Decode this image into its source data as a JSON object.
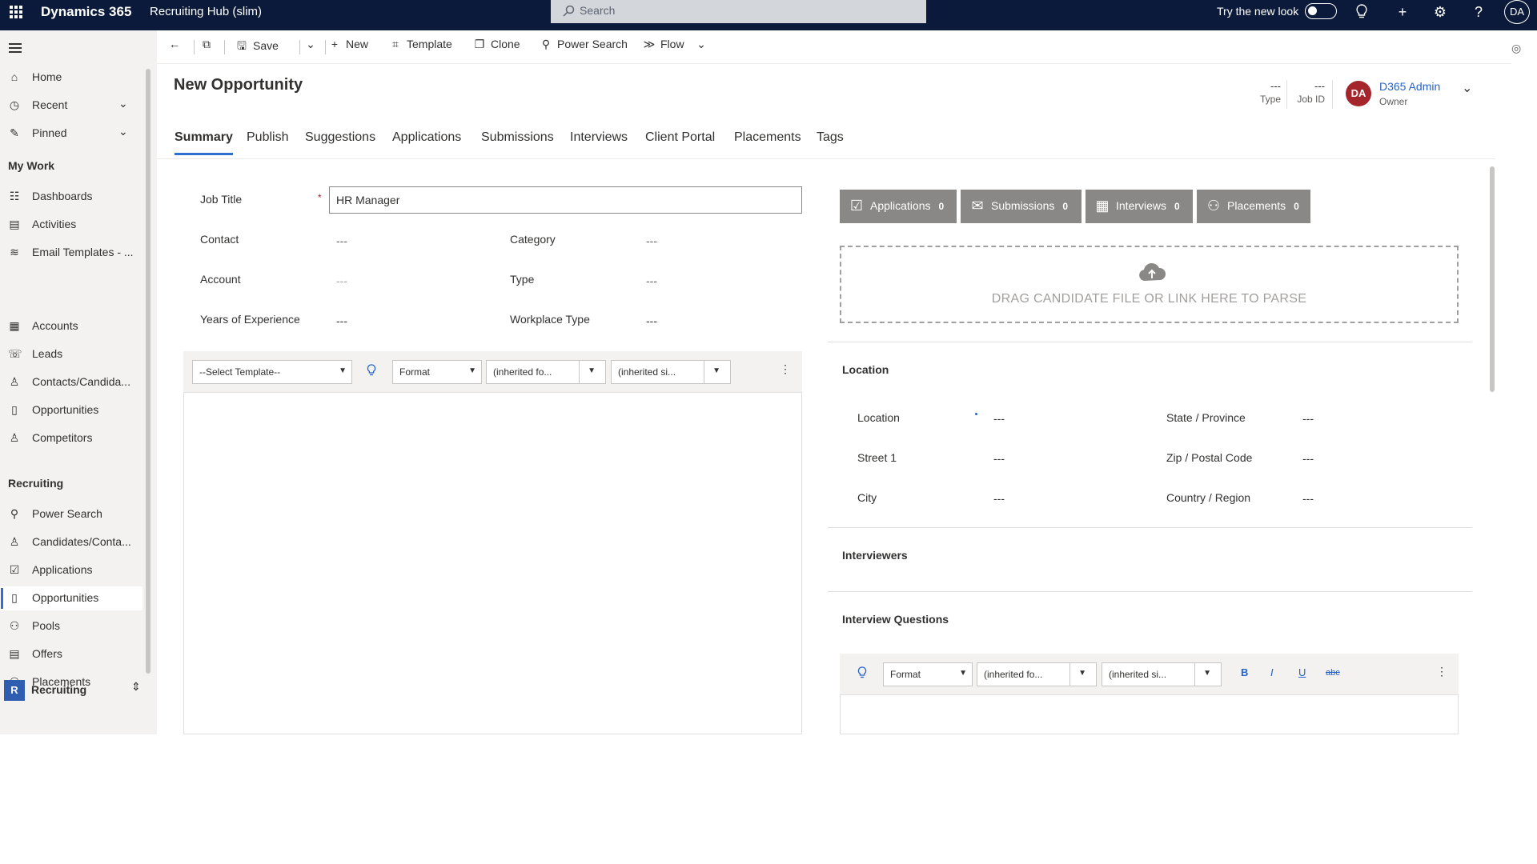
{
  "topbar": {
    "brand": "Dynamics 365",
    "app_name": "Recruiting Hub (slim)",
    "search_placeholder": "Search",
    "try_new_look": "Try the new look",
    "avatar_initials": "DA"
  },
  "nav": {
    "items_top": [
      {
        "label": "Home",
        "icon": "home-icon"
      },
      {
        "label": "Recent",
        "icon": "clock-icon"
      },
      {
        "label": "Pinned",
        "icon": "pin-icon"
      }
    ],
    "section_my_work": "My Work",
    "my_work": [
      {
        "label": "Dashboards",
        "icon": "dashboard-icon"
      },
      {
        "label": "Activities",
        "icon": "activities-icon"
      },
      {
        "label": "Email Templates - ...",
        "icon": "layers-icon"
      }
    ],
    "crm": [
      {
        "label": "Accounts",
        "icon": "accounts-icon"
      },
      {
        "label": "Leads",
        "icon": "phone-icon"
      },
      {
        "label": "Contacts/Candida...",
        "icon": "person-icon"
      },
      {
        "label": "Opportunities",
        "icon": "opportunity-icon"
      },
      {
        "label": "Competitors",
        "icon": "person-icon"
      }
    ],
    "section_recruiting": "Recruiting",
    "recruiting": [
      {
        "label": "Power Search",
        "icon": "search-icon"
      },
      {
        "label": "Candidates/Conta...",
        "icon": "person-icon"
      },
      {
        "label": "Applications",
        "icon": "check-icon"
      },
      {
        "label": "Opportunities",
        "icon": "opportunity-icon"
      },
      {
        "label": "Pools",
        "icon": "group-icon"
      },
      {
        "label": "Offers",
        "icon": "document-icon"
      },
      {
        "label": "Placements",
        "icon": "group-icon"
      }
    ],
    "area": {
      "initial": "R",
      "label": "Recruiting"
    }
  },
  "cmdbar": {
    "save": "Save",
    "new": "New",
    "template": "Template",
    "clone": "Clone",
    "power_search": "Power Search",
    "flow": "Flow"
  },
  "header": {
    "title": "New Opportunity",
    "type_value": "---",
    "type_label": "Type",
    "jobid_value": "---",
    "jobid_label": "Job ID",
    "owner_initials": "DA",
    "owner_name": "D365 Admin",
    "owner_label": "Owner"
  },
  "tabs": [
    "Summary",
    "Publish",
    "Suggestions",
    "Applications",
    "Submissions",
    "Interviews",
    "Client Portal",
    "Placements",
    "Tags"
  ],
  "form": {
    "job_title_label": "Job Title",
    "job_title_value": "HR Manager",
    "contact_label": "Contact",
    "contact_value": "---",
    "category_label": "Category",
    "category_value": "---",
    "account_label": "Account",
    "account_value": "---",
    "type_label": "Type",
    "type_value": "---",
    "years_label": "Years of Experience",
    "years_value": "---",
    "workplace_label": "Workplace Type",
    "workplace_value": "---"
  },
  "editor1": {
    "template": "--Select Template--",
    "format": "Format",
    "font": "(inherited fo...",
    "size": "(inherited si..."
  },
  "stats": [
    {
      "label": "Applications",
      "count": "0"
    },
    {
      "label": "Submissions",
      "count": "0"
    },
    {
      "label": "Interviews",
      "count": "0"
    },
    {
      "label": "Placements",
      "count": "0"
    }
  ],
  "dropzone": "DRAG CANDIDATE FILE OR LINK HERE TO PARSE",
  "location": {
    "title": "Location",
    "location_label": "Location",
    "location_value": "---",
    "state_label": "State / Province",
    "state_value": "---",
    "street_label": "Street 1",
    "street_value": "---",
    "zip_label": "Zip / Postal Code",
    "zip_value": "---",
    "city_label": "City",
    "city_value": "---",
    "country_label": "Country / Region",
    "country_value": "---"
  },
  "interviewers_title": "Interviewers",
  "interview_questions_title": "Interview Questions",
  "editor2": {
    "format": "Format",
    "font": "(inherited fo...",
    "size": "(inherited si...",
    "bold": "B",
    "italic": "I",
    "underline": "U",
    "strike": "abc"
  }
}
